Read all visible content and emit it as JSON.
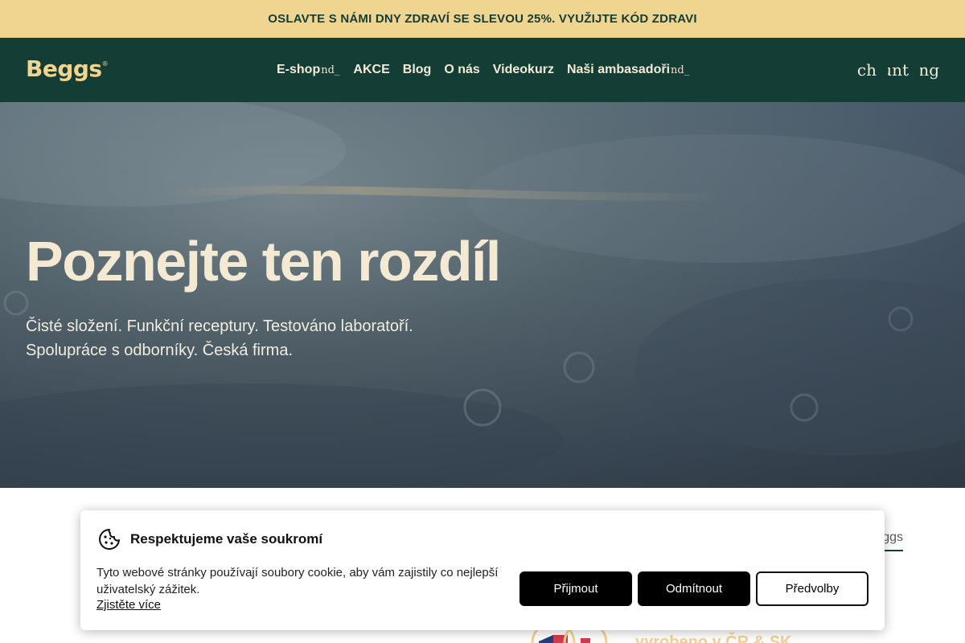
{
  "promo": {
    "text": "OSLAVTE S NÁMI DNY ZDRAVÍ SE SLEVOU 25%. VYUŽIJTE KÓD ZDRAVI"
  },
  "header": {
    "logo": "Beggs",
    "logo_mark": "®",
    "nav": [
      {
        "label": "E-shop",
        "glyph": "nd_"
      },
      {
        "label": "AKCE"
      },
      {
        "label": "Blog"
      },
      {
        "label": "O nás"
      },
      {
        "label": "Videokurz"
      },
      {
        "label": "Naši ambasadoři",
        "glyph": "nd_"
      }
    ],
    "icons": [
      {
        "name": "search-icon",
        "glyph": "search"
      },
      {
        "name": "account-icon",
        "glyph": "account_"
      },
      {
        "name": "cart-icon",
        "glyph": "shopping"
      }
    ]
  },
  "hero": {
    "title": "Poznejte ten rozdíl",
    "subtitle_line1": "Čisté složení. Funkční receptury. Testováno laboratoří.",
    "subtitle_line2": "Spolupráce s odborníky. Česká firma."
  },
  "content": {
    "partial_link": "Beggs",
    "made_in": "vyrobeno v ČR & SK"
  },
  "cookie": {
    "title": "Respektujeme vaše soukromí",
    "text": "Tyto webové stránky používají soubory cookie, aby vám zajistily co nejlepší uživatelský zážitek.",
    "link": "Zjistěte více",
    "accept": "Přijmout",
    "reject": "Odmítnout",
    "preferences": "Předvolby"
  },
  "colors": {
    "brand_dark": "#143d35",
    "brand_gold": "#f0d591",
    "hero_text": "#f4ead4"
  }
}
